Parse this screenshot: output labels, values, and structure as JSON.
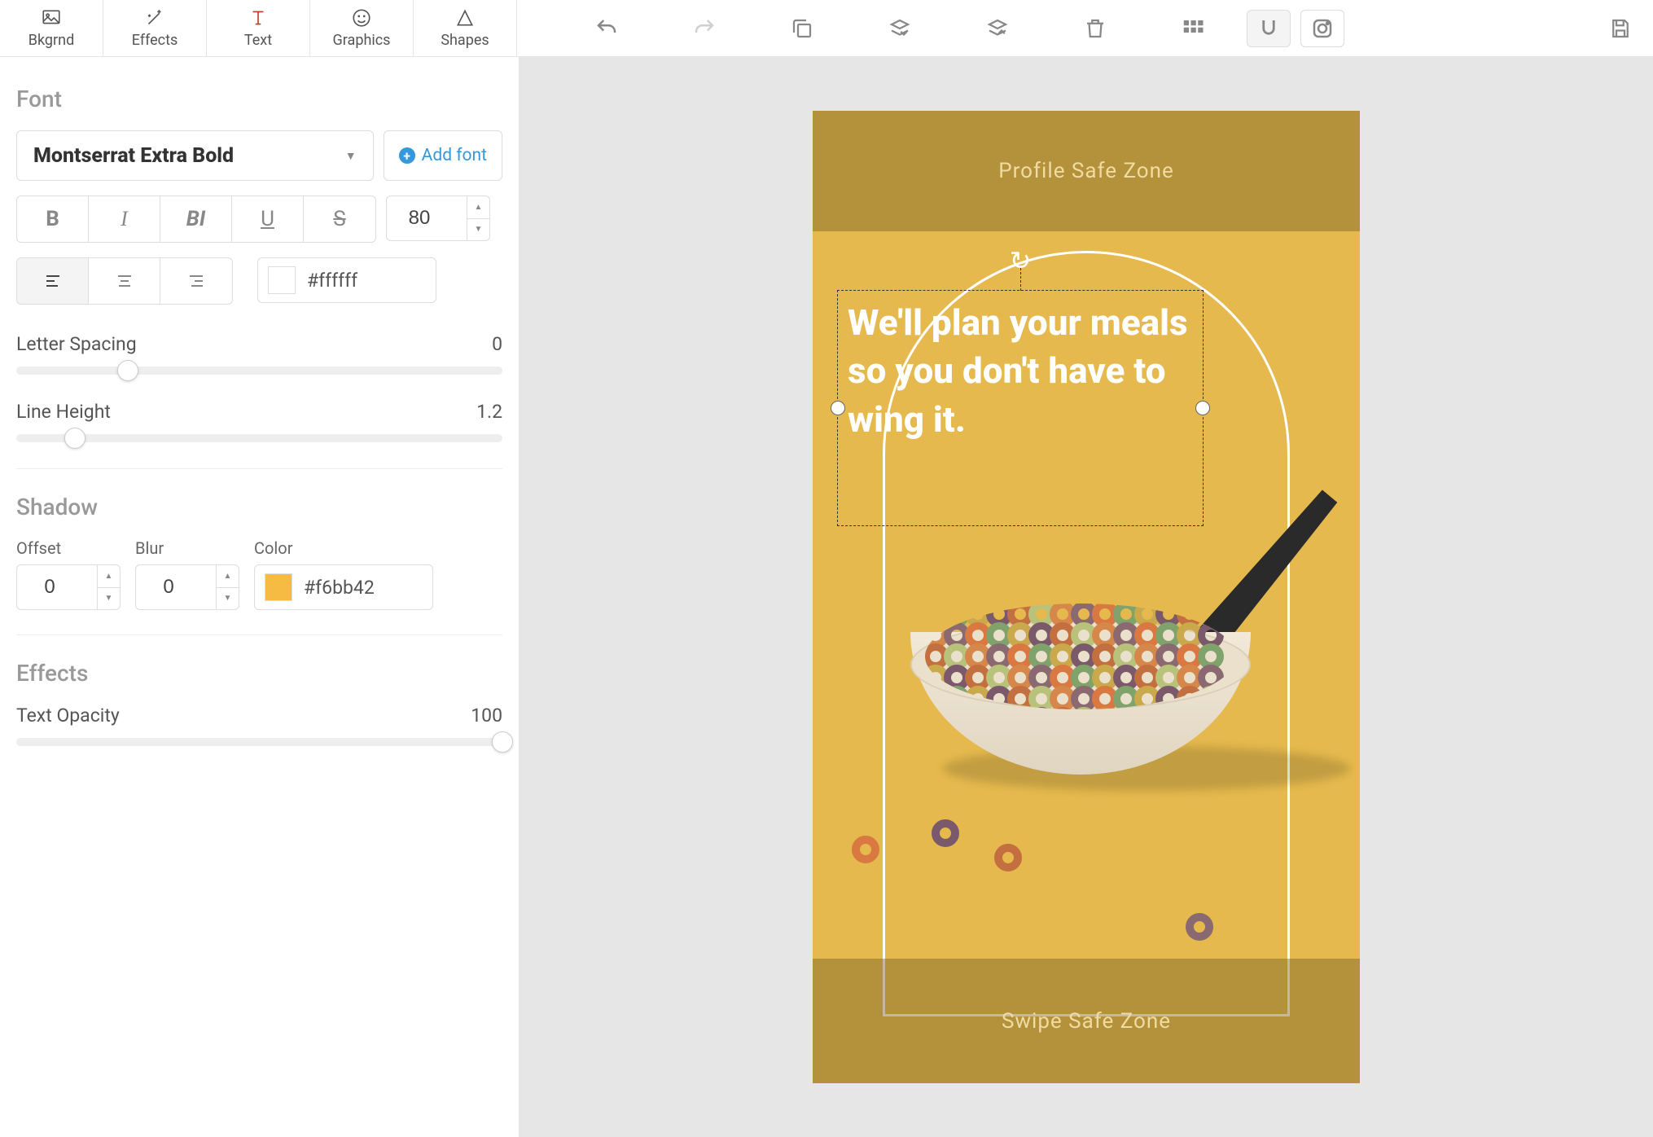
{
  "tabs": {
    "bkgrnd": "Bkgrnd",
    "effects": "Effects",
    "text": "Text",
    "graphics": "Graphics",
    "shapes": "Shapes"
  },
  "panel": {
    "font_title": "Font",
    "font_family": "Montserrat Extra Bold",
    "add_font": "Add font",
    "font_size": "80",
    "text_color": "#ffffff",
    "letter_spacing_label": "Letter Spacing",
    "letter_spacing_value": "0",
    "letter_spacing_pct": 23,
    "line_height_label": "Line Height",
    "line_height_value": "1.2",
    "line_height_pct": 12,
    "shadow_title": "Shadow",
    "shadow": {
      "offset_label": "Offset",
      "offset": "0",
      "blur_label": "Blur",
      "blur": "0",
      "color_label": "Color",
      "color": "#f6bb42"
    },
    "effects_title": "Effects",
    "text_opacity_label": "Text Opacity",
    "text_opacity_value": "100",
    "text_opacity_pct": 100
  },
  "canvas": {
    "profile_zone": "Profile Safe Zone",
    "swipe_zone": "Swipe Safe Zone",
    "headline": "We'll plan your meals so you don't have to wing it."
  }
}
